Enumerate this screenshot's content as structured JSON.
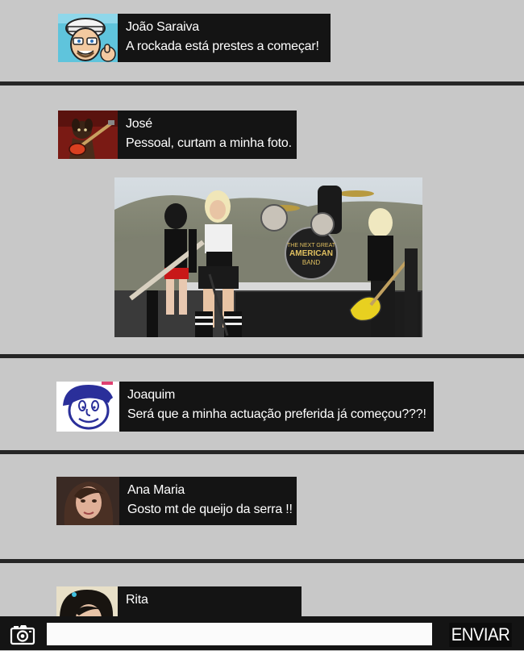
{
  "feed": {
    "posts": [
      {
        "author": "João Saraiva",
        "message": "A rockada está prestes a começar!",
        "avatar_icon": "cartoon-man-cap-avatar"
      },
      {
        "author": "José",
        "message": "Pessoal, curtam a minha foto.",
        "avatar_icon": "guitar-dog-avatar"
      },
      {
        "author": "Joaquim",
        "message": "Será que a minha actuação preferida já começou???!",
        "avatar_icon": "cartoon-face-avatar"
      },
      {
        "author": "Ana Maria",
        "message": "Gosto mt de queijo da serra !!",
        "avatar_icon": "woman-photo-avatar"
      },
      {
        "author": "Rita",
        "message": "",
        "avatar_icon": "woman-dark-hair-avatar"
      }
    ],
    "photo": {
      "description_icon": "concert-photo",
      "drum_text_1": "THE NEXT GREAT",
      "drum_text_2": "AMERICAN",
      "drum_text_3": "BAND"
    }
  },
  "composer": {
    "input_value": "",
    "input_placeholder": "",
    "send_label": "ENVIAR",
    "camera_icon": "camera-icon"
  },
  "colors": {
    "background": "#c8c8c8",
    "bubble": "#141414",
    "divider": "#262626",
    "text": "#ffffff"
  }
}
